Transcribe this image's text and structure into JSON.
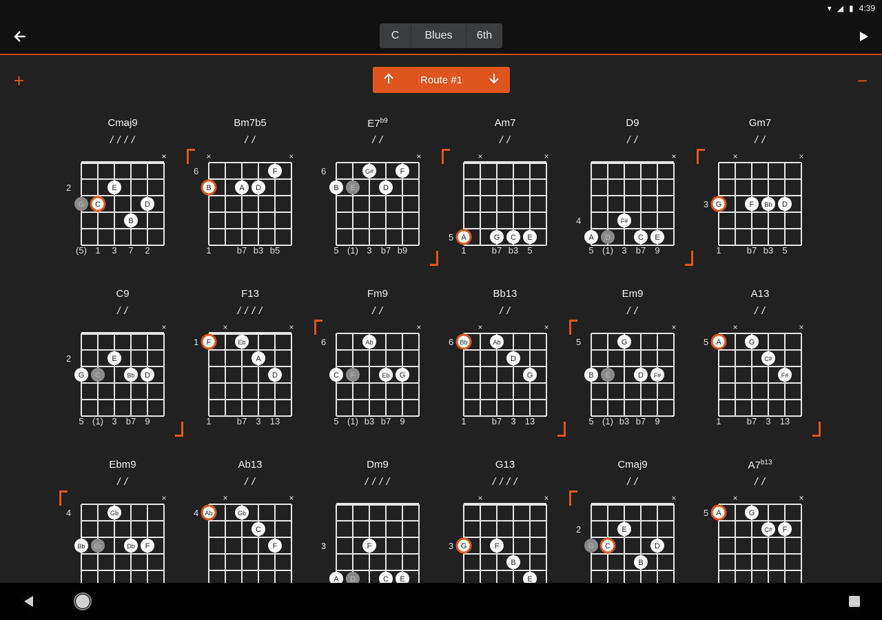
{
  "status": {
    "time": "4:39"
  },
  "toolbar": {
    "segments": [
      "C",
      "Blues",
      "6th"
    ]
  },
  "route": {
    "label": "Route #1"
  },
  "colors": {
    "accent": "#e0541e",
    "bg": "#212121"
  },
  "chords": [
    {
      "name": "Cmaj9",
      "strum": "/ / / /",
      "fret": "2",
      "fret_row": 1,
      "nut": true,
      "bracket": "none",
      "x": [
        5
      ],
      "dots": [
        {
          "s": 0,
          "r": 2,
          "t": "G",
          "k": "g"
        },
        {
          "s": 1,
          "r": 2,
          "t": "C",
          "k": "r"
        },
        {
          "s": 2,
          "r": 1,
          "t": "E",
          "k": "w"
        },
        {
          "s": 3,
          "r": 3,
          "t": "B",
          "k": "w"
        },
        {
          "s": 4,
          "r": 2,
          "t": "D",
          "k": "w"
        }
      ],
      "iv": [
        {
          "s": 0,
          "t": "(5)"
        },
        {
          "s": 1,
          "t": "1"
        },
        {
          "s": 2,
          "t": "3"
        },
        {
          "s": 3,
          "t": "7"
        },
        {
          "s": 4,
          "t": "2"
        }
      ]
    },
    {
      "name": "Bm7b5",
      "strum": "/ /",
      "fret": "6",
      "fret_row": 0,
      "nut": false,
      "bracket": "tl",
      "x": [
        0,
        5
      ],
      "dots": [
        {
          "s": 0,
          "r": 1,
          "t": "B",
          "k": "r"
        },
        {
          "s": 2,
          "r": 1,
          "t": "A",
          "k": "w"
        },
        {
          "s": 3,
          "r": 1,
          "t": "D",
          "k": "w"
        },
        {
          "s": 4,
          "r": 0,
          "t": "F",
          "k": "w"
        }
      ],
      "iv": [
        {
          "s": 0,
          "t": "1"
        },
        {
          "s": 2,
          "t": "b7"
        },
        {
          "s": 3,
          "t": "b3"
        },
        {
          "s": 4,
          "t": "b5"
        }
      ]
    },
    {
      "name": "E7",
      "sup": "b9",
      "strum": "/ /",
      "fret": "6",
      "fret_row": 0,
      "nut": false,
      "bracket": "br",
      "x": [
        5
      ],
      "dots": [
        {
          "s": 0,
          "r": 1,
          "t": "B",
          "k": "w"
        },
        {
          "s": 1,
          "r": 1,
          "t": "E",
          "k": "g"
        },
        {
          "s": 2,
          "r": 0,
          "t": "G#",
          "k": "w"
        },
        {
          "s": 3,
          "r": 1,
          "t": "D",
          "k": "w"
        },
        {
          "s": 4,
          "r": 0,
          "t": "F",
          "k": "w"
        }
      ],
      "iv": [
        {
          "s": 0,
          "t": "5"
        },
        {
          "s": 1,
          "t": "(1)"
        },
        {
          "s": 2,
          "t": "3"
        },
        {
          "s": 3,
          "t": "b7"
        },
        {
          "s": 4,
          "t": "b9"
        }
      ]
    },
    {
      "name": "Am7",
      "strum": "/ /",
      "fret": "5",
      "fret_row": 4,
      "nut": true,
      "bracket": "tl",
      "x": [
        1,
        5
      ],
      "dots": [
        {
          "s": 0,
          "r": 4,
          "t": "A",
          "k": "r"
        },
        {
          "s": 2,
          "r": 4,
          "t": "G",
          "k": "w"
        },
        {
          "s": 3,
          "r": 4,
          "t": "C",
          "k": "w"
        },
        {
          "s": 4,
          "r": 4,
          "t": "E",
          "k": "w"
        }
      ],
      "iv": [
        {
          "s": 0,
          "t": "1"
        },
        {
          "s": 2,
          "t": "b7"
        },
        {
          "s": 3,
          "t": "b3"
        },
        {
          "s": 4,
          "t": "5"
        }
      ]
    },
    {
      "name": "D9",
      "strum": "/ /",
      "fret": "4",
      "fret_row": 3,
      "nut": true,
      "bracket": "br",
      "x": [
        5
      ],
      "dots": [
        {
          "s": 0,
          "r": 4,
          "t": "A",
          "k": "w"
        },
        {
          "s": 1,
          "r": 4,
          "t": "D",
          "k": "g"
        },
        {
          "s": 2,
          "r": 3,
          "t": "F#",
          "k": "w"
        },
        {
          "s": 3,
          "r": 4,
          "t": "C",
          "k": "w"
        },
        {
          "s": 4,
          "r": 4,
          "t": "E",
          "k": "w"
        }
      ],
      "iv": [
        {
          "s": 0,
          "t": "5"
        },
        {
          "s": 1,
          "t": "(1)"
        },
        {
          "s": 2,
          "t": "3"
        },
        {
          "s": 3,
          "t": "b7"
        },
        {
          "s": 4,
          "t": "9"
        }
      ]
    },
    {
      "name": "Gm7",
      "strum": "/ /",
      "fret": "3",
      "fret_row": 2,
      "nut": false,
      "bracket": "tl",
      "x": [
        1,
        5
      ],
      "dots": [
        {
          "s": 0,
          "r": 2,
          "t": "G",
          "k": "r"
        },
        {
          "s": 2,
          "r": 2,
          "t": "F",
          "k": "w"
        },
        {
          "s": 3,
          "r": 2,
          "t": "Bb",
          "k": "w"
        },
        {
          "s": 4,
          "r": 2,
          "t": "D",
          "k": "w"
        }
      ],
      "iv": [
        {
          "s": 0,
          "t": "1"
        },
        {
          "s": 2,
          "t": "b7"
        },
        {
          "s": 3,
          "t": "b3"
        },
        {
          "s": 4,
          "t": "5"
        }
      ]
    },
    {
      "name": "C9",
      "strum": "/ /",
      "fret": "2",
      "fret_row": 1,
      "nut": true,
      "bracket": "br",
      "x": [
        5
      ],
      "dots": [
        {
          "s": 0,
          "r": 2,
          "t": "G",
          "k": "w"
        },
        {
          "s": 1,
          "r": 2,
          "t": "C",
          "k": "g"
        },
        {
          "s": 2,
          "r": 1,
          "t": "E",
          "k": "w"
        },
        {
          "s": 3,
          "r": 2,
          "t": "Bb",
          "k": "w"
        },
        {
          "s": 4,
          "r": 2,
          "t": "D",
          "k": "w"
        }
      ],
      "iv": [
        {
          "s": 0,
          "t": "5"
        },
        {
          "s": 1,
          "t": "(1)"
        },
        {
          "s": 2,
          "t": "3"
        },
        {
          "s": 3,
          "t": "b7"
        },
        {
          "s": 4,
          "t": "9"
        }
      ]
    },
    {
      "name": "F13",
      "strum": "/ / / /",
      "fret": "1",
      "fret_row": 0,
      "nut": true,
      "bracket": "none",
      "x": [
        1,
        5
      ],
      "dots": [
        {
          "s": 0,
          "r": 0,
          "t": "F",
          "k": "r"
        },
        {
          "s": 2,
          "r": 0,
          "t": "Eb",
          "k": "w"
        },
        {
          "s": 3,
          "r": 1,
          "t": "A",
          "k": "w"
        },
        {
          "s": 4,
          "r": 2,
          "t": "D",
          "k": "w"
        }
      ],
      "iv": [
        {
          "s": 0,
          "t": "1"
        },
        {
          "s": 2,
          "t": "b7"
        },
        {
          "s": 3,
          "t": "3"
        },
        {
          "s": 4,
          "t": "13"
        }
      ]
    },
    {
      "name": "Fm9",
      "strum": "/ /",
      "fret": "6",
      "fret_row": 0,
      "nut": false,
      "bracket": "tl",
      "x": [
        5
      ],
      "dots": [
        {
          "s": 0,
          "r": 2,
          "t": "C",
          "k": "w"
        },
        {
          "s": 1,
          "r": 2,
          "t": "F",
          "k": "g"
        },
        {
          "s": 2,
          "r": 0,
          "t": "Ab",
          "k": "w"
        },
        {
          "s": 3,
          "r": 2,
          "t": "Eb",
          "k": "w"
        },
        {
          "s": 4,
          "r": 2,
          "t": "G",
          "k": "w"
        }
      ],
      "iv": [
        {
          "s": 0,
          "t": "5"
        },
        {
          "s": 1,
          "t": "(1)"
        },
        {
          "s": 2,
          "t": "b3"
        },
        {
          "s": 3,
          "t": "b7"
        },
        {
          "s": 4,
          "t": "9"
        }
      ]
    },
    {
      "name": "Bb13",
      "strum": "/ /",
      "fret": "6",
      "fret_row": 0,
      "nut": false,
      "bracket": "br",
      "x": [
        1,
        5
      ],
      "dots": [
        {
          "s": 0,
          "r": 0,
          "t": "Bb",
          "k": "r"
        },
        {
          "s": 2,
          "r": 0,
          "t": "Ab",
          "k": "w"
        },
        {
          "s": 3,
          "r": 1,
          "t": "D",
          "k": "w"
        },
        {
          "s": 4,
          "r": 2,
          "t": "G",
          "k": "w"
        }
      ],
      "iv": [
        {
          "s": 0,
          "t": "1"
        },
        {
          "s": 2,
          "t": "b7"
        },
        {
          "s": 3,
          "t": "3"
        },
        {
          "s": 4,
          "t": "13"
        }
      ]
    },
    {
      "name": "Em9",
      "strum": "/ /",
      "fret": "5",
      "fret_row": 0,
      "nut": false,
      "bracket": "tl",
      "x": [
        5
      ],
      "dots": [
        {
          "s": 0,
          "r": 2,
          "t": "B",
          "k": "w"
        },
        {
          "s": 1,
          "r": 2,
          "t": "E",
          "k": "g"
        },
        {
          "s": 2,
          "r": 0,
          "t": "G",
          "k": "w"
        },
        {
          "s": 3,
          "r": 2,
          "t": "D",
          "k": "w"
        },
        {
          "s": 4,
          "r": 2,
          "t": "F#",
          "k": "w"
        }
      ],
      "iv": [
        {
          "s": 0,
          "t": "5"
        },
        {
          "s": 1,
          "t": "(1)"
        },
        {
          "s": 2,
          "t": "b3"
        },
        {
          "s": 3,
          "t": "b7"
        },
        {
          "s": 4,
          "t": "9"
        }
      ]
    },
    {
      "name": "A13",
      "strum": "/ /",
      "fret": "5",
      "fret_row": 0,
      "nut": false,
      "bracket": "br",
      "x": [
        1,
        5
      ],
      "dots": [
        {
          "s": 0,
          "r": 0,
          "t": "A",
          "k": "r"
        },
        {
          "s": 2,
          "r": 0,
          "t": "G",
          "k": "w"
        },
        {
          "s": 3,
          "r": 1,
          "t": "C#",
          "k": "w"
        },
        {
          "s": 4,
          "r": 2,
          "t": "F#",
          "k": "w"
        }
      ],
      "iv": [
        {
          "s": 0,
          "t": "1"
        },
        {
          "s": 2,
          "t": "b7"
        },
        {
          "s": 3,
          "t": "3"
        },
        {
          "s": 4,
          "t": "13"
        }
      ]
    },
    {
      "name": "Ebm9",
      "strum": "/ /",
      "fret": "4",
      "fret_row": 0,
      "nut": false,
      "bracket": "tl",
      "x": [
        5
      ],
      "dots": [
        {
          "s": 0,
          "r": 2,
          "t": "Bb",
          "k": "w"
        },
        {
          "s": 1,
          "r": 2,
          "t": "Eb",
          "k": "g"
        },
        {
          "s": 2,
          "r": 0,
          "t": "Gb",
          "k": "w"
        },
        {
          "s": 3,
          "r": 2,
          "t": "Db",
          "k": "w"
        },
        {
          "s": 4,
          "r": 2,
          "t": "F",
          "k": "w"
        }
      ],
      "iv": []
    },
    {
      "name": "Ab13",
      "strum": "/ /",
      "fret": "4",
      "fret_row": 0,
      "nut": false,
      "bracket": "none",
      "x": [
        1,
        5
      ],
      "dots": [
        {
          "s": 0,
          "r": 0,
          "t": "Ab",
          "k": "r"
        },
        {
          "s": 2,
          "r": 0,
          "t": "Gb",
          "k": "w"
        },
        {
          "s": 3,
          "r": 1,
          "t": "C",
          "k": "w"
        },
        {
          "s": 4,
          "r": 2,
          "t": "F",
          "k": "w"
        }
      ],
      "iv": []
    },
    {
      "name": "Dm9",
      "strum": "/ / / /",
      "fret": "3",
      "fret_row": 2,
      "nut": true,
      "bracket": "none",
      "x": [],
      "dots": [
        {
          "s": 2,
          "r": 2,
          "t": "F",
          "k": "w"
        },
        {
          "s": 0,
          "r": 4,
          "t": "A",
          "k": "w"
        },
        {
          "s": 1,
          "r": 4,
          "t": "D",
          "k": "g"
        },
        {
          "s": 3,
          "r": 4,
          "t": "C",
          "k": "w"
        },
        {
          "s": 4,
          "r": 4,
          "t": "E",
          "k": "w"
        }
      ],
      "iv": []
    },
    {
      "name": "G13",
      "strum": "/ / / /",
      "fret": "3",
      "fret_row": 2,
      "nut": true,
      "bracket": "none",
      "x": [
        1,
        5
      ],
      "dots": [
        {
          "s": 0,
          "r": 2,
          "t": "G",
          "k": "r"
        },
        {
          "s": 2,
          "r": 2,
          "t": "F",
          "k": "w"
        },
        {
          "s": 3,
          "r": 3,
          "t": "B",
          "k": "w"
        },
        {
          "s": 4,
          "r": 4,
          "t": "E",
          "k": "w"
        }
      ],
      "iv": []
    },
    {
      "name": "Cmaj9",
      "strum": "/ /",
      "fret": "2",
      "fret_row": 1,
      "nut": true,
      "bracket": "tl",
      "x": [
        5
      ],
      "dots": [
        {
          "s": 0,
          "r": 2,
          "t": "G",
          "k": "g"
        },
        {
          "s": 1,
          "r": 2,
          "t": "C",
          "k": "r"
        },
        {
          "s": 2,
          "r": 1,
          "t": "E",
          "k": "w"
        },
        {
          "s": 3,
          "r": 3,
          "t": "B",
          "k": "w"
        },
        {
          "s": 4,
          "r": 2,
          "t": "D",
          "k": "w"
        }
      ],
      "iv": []
    },
    {
      "name": "A7",
      "sup": "b13",
      "strum": "/ /",
      "fret": "5",
      "fret_row": 0,
      "nut": false,
      "bracket": "none",
      "x": [
        1,
        5
      ],
      "dots": [
        {
          "s": 0,
          "r": 0,
          "t": "A",
          "k": "r"
        },
        {
          "s": 2,
          "r": 0,
          "t": "G",
          "k": "w"
        },
        {
          "s": 3,
          "r": 1,
          "t": "C#",
          "k": "w"
        },
        {
          "s": 4,
          "r": 1,
          "t": "F",
          "k": "w"
        }
      ],
      "iv": []
    }
  ]
}
